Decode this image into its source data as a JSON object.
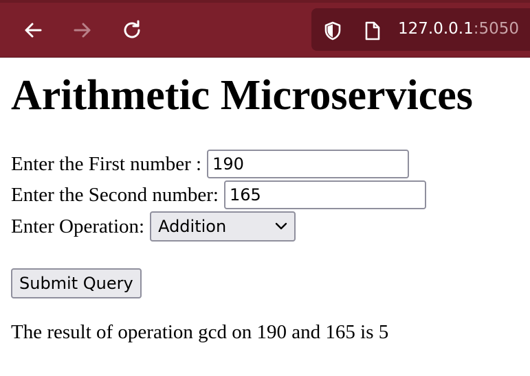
{
  "browser": {
    "url_host": "127.0.0.1",
    "url_port": ":5050",
    "toolbar_color": "#7b1f2b"
  },
  "page": {
    "title": "Arithmetic Microservices",
    "first_label": "Enter the First number :",
    "first_value": "190",
    "second_label": "Enter the Second number:",
    "second_value": "165",
    "operation_label": "Enter Operation:",
    "operation_selected": "Addition",
    "submit_label": "Submit Query",
    "result_text": "The result of operation gcd on 190 and 165 is 5"
  },
  "icons": {
    "back": "arrow-left-icon",
    "forward": "arrow-right-icon",
    "reload": "reload-icon",
    "shield": "shield-icon",
    "page": "page-icon",
    "dropdown": "chevron-down-icon"
  }
}
